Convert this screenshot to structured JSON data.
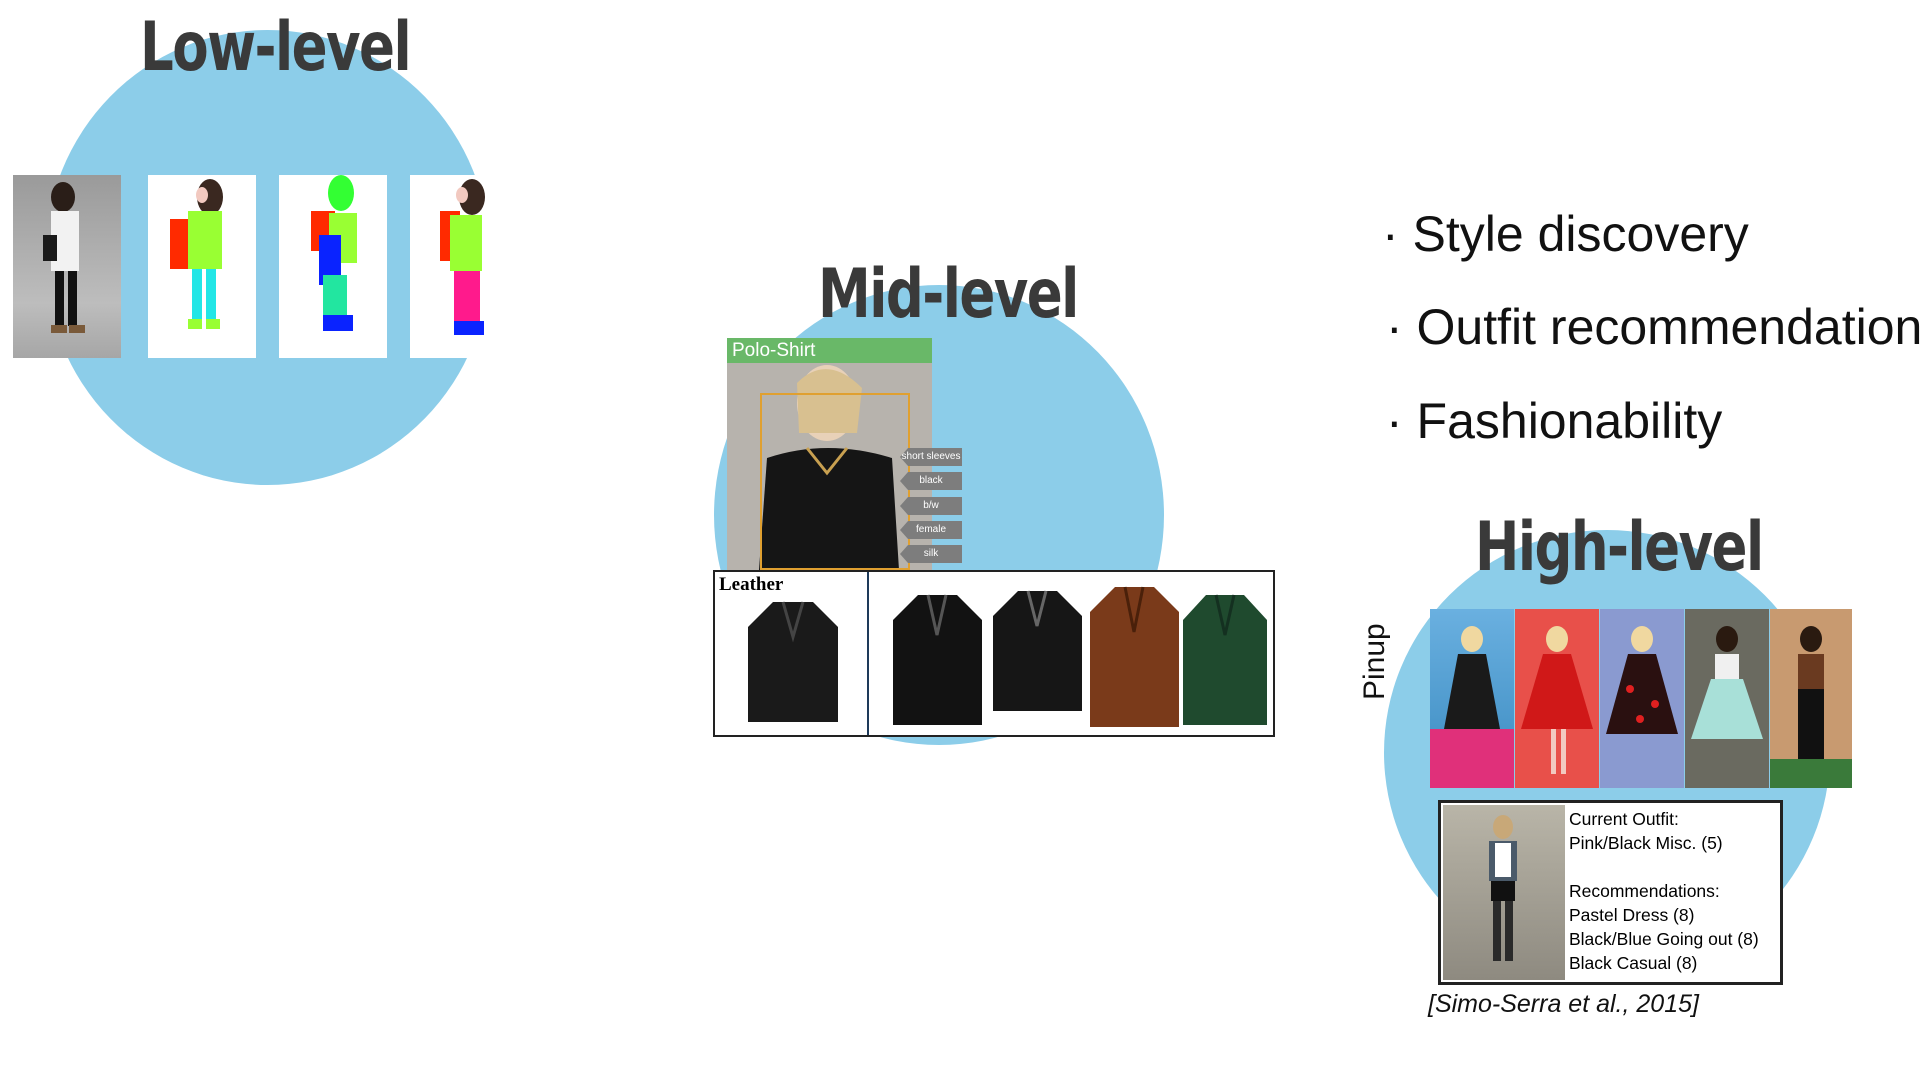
{
  "low_level": {
    "title": "Low-level",
    "color": "#8ccde9"
  },
  "mid_level": {
    "title": "Mid-level",
    "detection_label": "Polo-Shirt",
    "attribute_tags": [
      "short sleeves",
      "black",
      "b/w",
      "female",
      "silk"
    ],
    "jacket_label": "Leather"
  },
  "high_level": {
    "title": "High-level",
    "style_label": "Pinup",
    "current_outfit_header": "Current Outfit:",
    "current_outfit_value": "Pink/Black Misc. (5)",
    "recommendations_header": "Recommendations:",
    "recommendations": [
      "Pastel Dress (8)",
      "Black/Blue Going out (8)",
      "Black Casual (8)"
    ],
    "citation": "[Simo-Serra et al., 2015]"
  },
  "bullets": [
    "· Style discovery",
    "· Outfit recommendation",
    "· Fashionability"
  ],
  "icons": [
    "person-photo",
    "segmentation-mask",
    "jacket-image",
    "pinup-photo",
    "outfit-photo"
  ]
}
